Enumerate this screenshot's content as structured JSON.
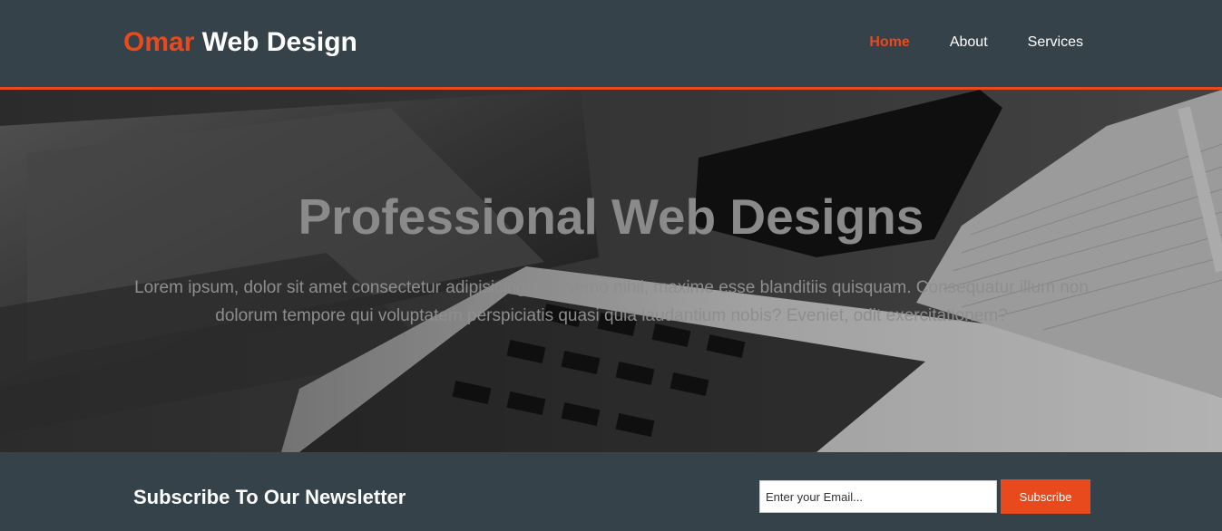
{
  "header": {
    "brand_highlight": "Omar",
    "brand_rest": " Web Design",
    "nav": [
      {
        "label": "Home",
        "current": true
      },
      {
        "label": "About",
        "current": false
      },
      {
        "label": "Services",
        "current": false
      }
    ]
  },
  "showcase": {
    "title": "Professional Web Designs",
    "text": "Lorem ipsum, dolor sit amet consectetur adipisicing elit. Nemo nihil, maxime esse blanditiis quisquam. Consequatur illum non dolorum tempore qui voluptatem perspiciatis quasi quia laudantium nobis? Eveniet, odit exercitationem?",
    "background": "laptop-desk-photo"
  },
  "newsletter": {
    "heading": "Subscribe To Our Newsletter",
    "email_placeholder": "Enter your Email...",
    "email_value": "",
    "button_label": "Subscribe"
  },
  "colors": {
    "accent": "#e8491d",
    "dark": "#35424a",
    "white": "#ffffff"
  }
}
